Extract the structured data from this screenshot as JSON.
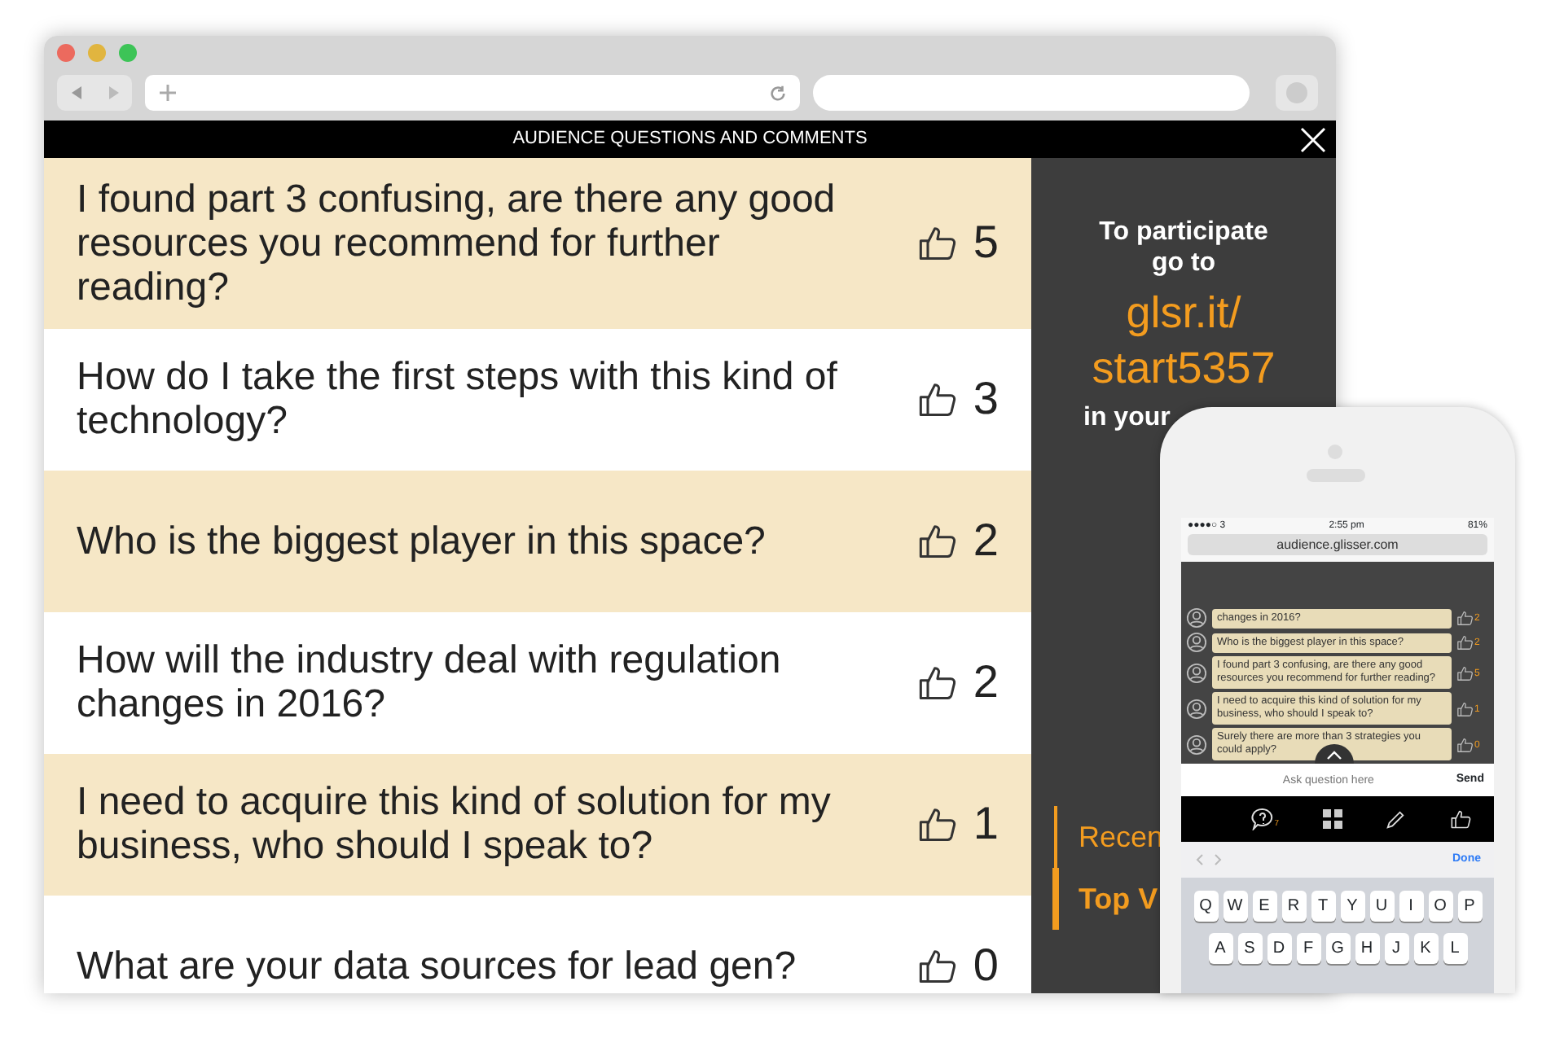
{
  "browser": {
    "header": {
      "title": "AUDIENCE QUESTIONS AND COMMENTS"
    }
  },
  "questions": [
    {
      "text": "I found part 3 confusing, are there any good resources you recommend for further reading?",
      "votes": "5",
      "highlighted": true
    },
    {
      "text": "How do I take the first steps with this kind of technology?",
      "votes": "3",
      "highlighted": false
    },
    {
      "text": "Who is the biggest player in this space?",
      "votes": "2",
      "highlighted": true
    },
    {
      "text": "How will the industry deal with regulation changes in 2016?",
      "votes": "2",
      "highlighted": false
    },
    {
      "text": "I need to acquire this kind of solution for my business, who should I speak to?",
      "votes": "1",
      "highlighted": true
    },
    {
      "text": "What are your data sources for lead gen?",
      "votes": "0",
      "highlighted": false
    }
  ],
  "sidebar": {
    "intro": [
      "To participate",
      "go to"
    ],
    "link": [
      "glsr.it/",
      "start5357"
    ],
    "outro": "in your",
    "tabs": [
      {
        "label": "Recen",
        "selected": false
      },
      {
        "label": "Top V",
        "selected": true
      }
    ]
  },
  "phone": {
    "status": {
      "carrier": "●●●●○ 3",
      "time": "2:55 pm",
      "battery": "81%"
    },
    "url": "audience.glisser.com",
    "questions": [
      {
        "text": "changes in 2016?",
        "votes": "2"
      },
      {
        "text": "Who is the biggest player in this space?",
        "votes": "2"
      },
      {
        "text": "I found part 3 confusing, are there any good resources you recommend for further reading?",
        "votes": "5"
      },
      {
        "text": "I need to acquire this kind of solution for my business, who should I speak to?",
        "votes": "1"
      },
      {
        "text": "Surely there are more than 3 strategies you could apply?",
        "votes": "0"
      }
    ],
    "input": {
      "placeholder": "Ask question here",
      "send": "Send"
    },
    "toolbar": {
      "badge": "7"
    },
    "keyboard": {
      "done": "Done",
      "rows": [
        [
          "Q",
          "W",
          "E",
          "R",
          "T",
          "Y",
          "U",
          "I",
          "O",
          "P"
        ],
        [
          "A",
          "S",
          "D",
          "F",
          "G",
          "H",
          "J",
          "K",
          "L"
        ]
      ]
    }
  }
}
